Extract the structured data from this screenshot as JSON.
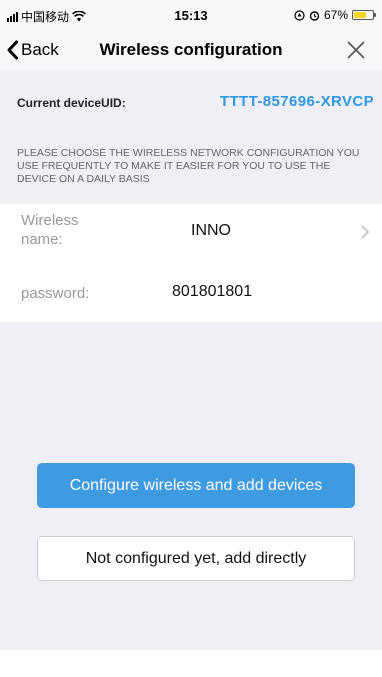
{
  "status_bar": {
    "carrier": "中国移动",
    "time": "15:13",
    "battery_percent": "67%",
    "battery_level": 0.67,
    "signal_icon": "signal-bars-icon",
    "wifi_icon": "wifi-icon",
    "location_icon": "location-lock-icon",
    "alarm_icon": "alarm-icon"
  },
  "nav": {
    "back_label": "Back",
    "title": "Wireless configuration",
    "close_icon": "close-icon"
  },
  "device": {
    "uid_label": "Current deviceUID:",
    "uid_value": "TTTT-857696-XRVCP"
  },
  "hint": "PLEASE CHOOSE THE WIRELESS NETWORK CONFIGURATION YOU USE FREQUENTLY TO MAKE IT EASIER FOR YOU TO USE THE DEVICE ON A DAILY BASIS",
  "form": {
    "ssid_label": "Wireless name:",
    "ssid_value": "INNO",
    "password_label": "password:",
    "password_value": "801801801"
  },
  "actions": {
    "primary_label": "Configure wireless and add devices",
    "secondary_label": "Not configured yet, add directly"
  },
  "colors": {
    "accent": "#3e9be2",
    "uid_text": "#2f98e3",
    "background": "#f0eff5",
    "battery": "#f6d51f"
  }
}
